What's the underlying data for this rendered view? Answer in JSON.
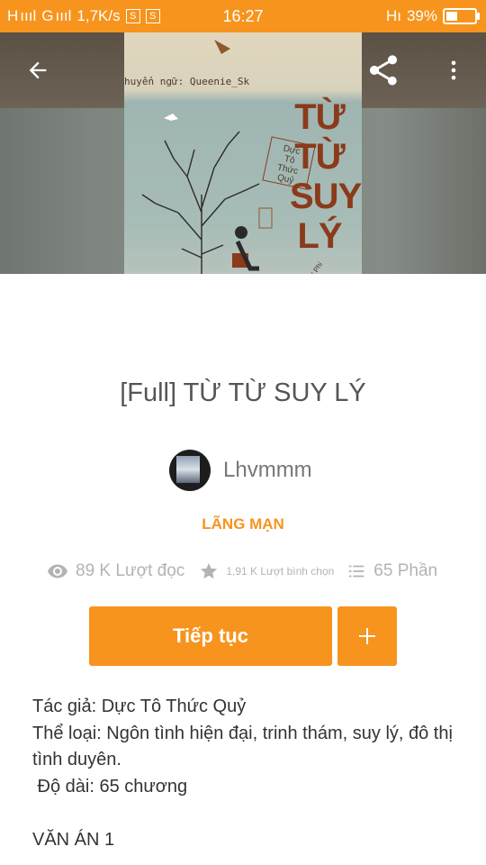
{
  "status_bar": {
    "network": "H",
    "signal1": "ıııl",
    "network2": "G",
    "signal2": "ıııl",
    "speed": "1,7K/s",
    "icon_s": "S",
    "time": "16:27",
    "network3": "Hı",
    "battery": "39%"
  },
  "cover": {
    "translator": "huyển ngữ: Queenie_Sk",
    "title_lines": [
      "TỪ",
      "TỪ",
      "SUY",
      "LÝ"
    ],
    "author_lines": [
      "Dực",
      "Tô",
      "Thức",
      "Quỷ"
    ],
    "credit": "Des by Mộc Y Phi"
  },
  "story": {
    "title": "[Full] TỪ TỪ SUY LÝ",
    "author": "Lhvmmm",
    "genre": "LÃNG MẠN"
  },
  "stats": {
    "reads": "89 K Lượt đọc",
    "votes": "1,91 K Lượt bình chọn",
    "parts": "65 Phần"
  },
  "actions": {
    "continue_label": "Tiếp tục",
    "add_label": "+"
  },
  "description": {
    "line1": "Tác giả: Dực Tô Thức Quỷ",
    "line2": "Thể loại: Ngôn tình hiện đại, trinh thám, suy lý, đô thị tình duyên.",
    "line3": " Độ dài: 65 chương",
    "line4": "VĂN ÁN 1"
  },
  "icons": {
    "back": "back-arrow-icon",
    "share": "share-icon",
    "more": "more-vert-icon",
    "reads": "eye-icon",
    "votes": "star-icon",
    "parts": "list-icon"
  },
  "colors": {
    "accent": "#f7941d",
    "text_secondary": "#b3b3b3"
  }
}
